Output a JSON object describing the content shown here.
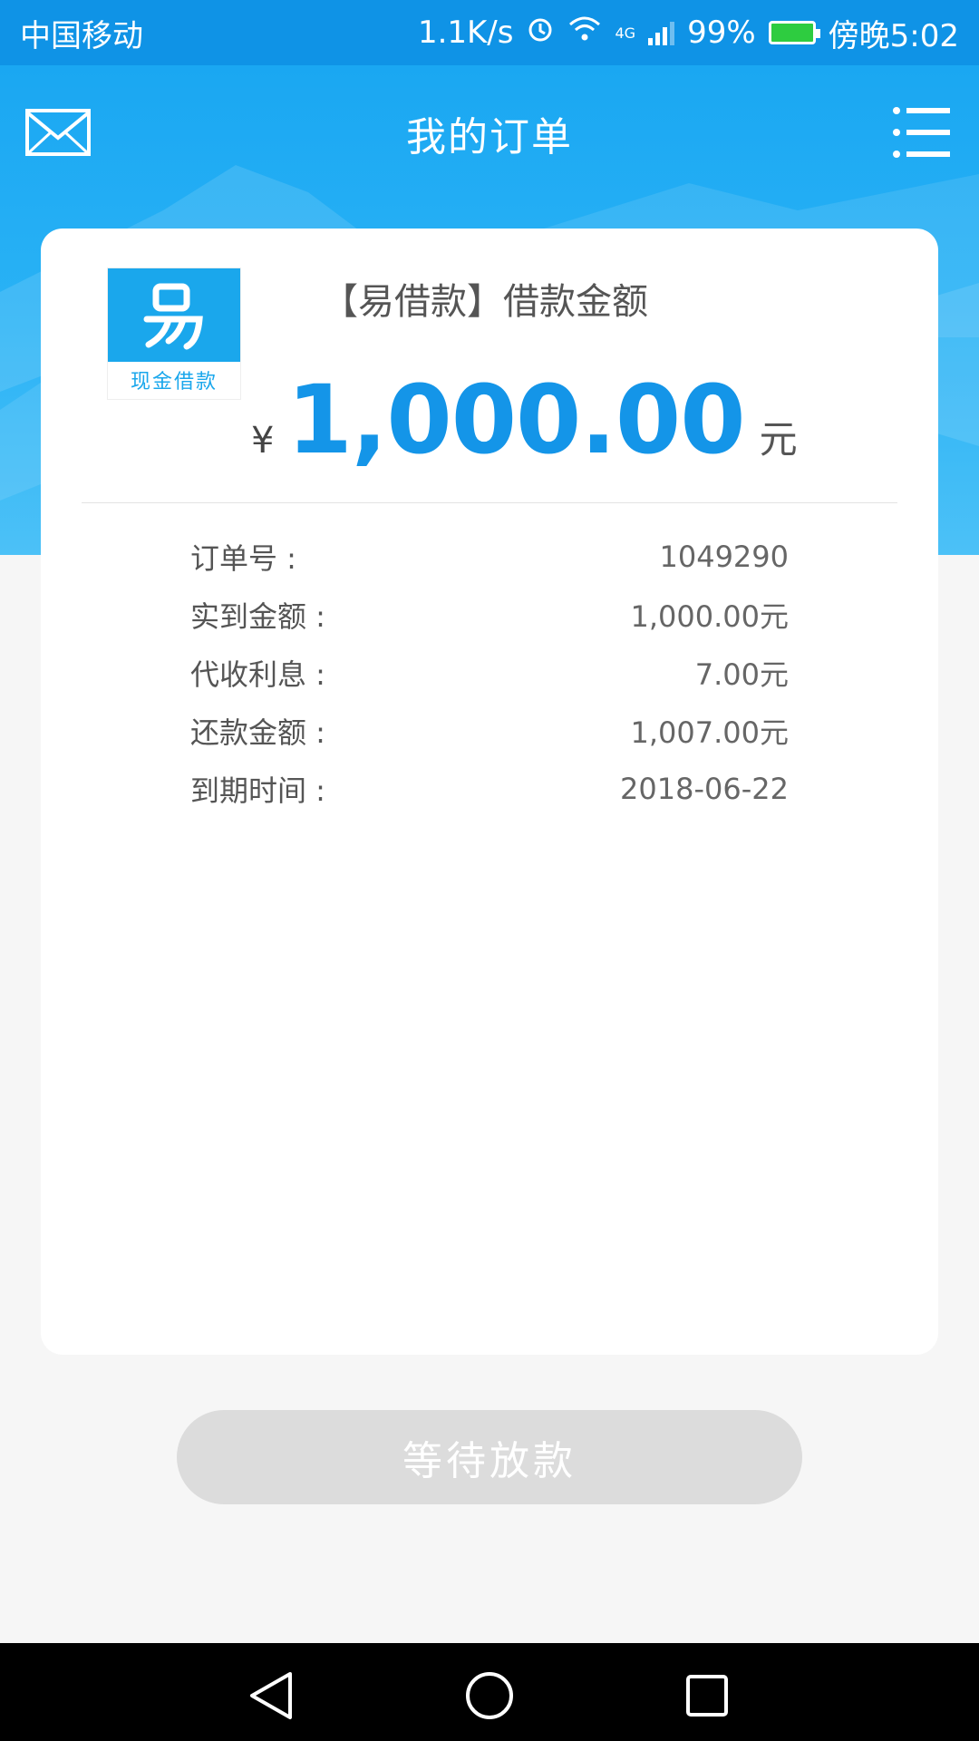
{
  "status_bar": {
    "carrier": "中国移动",
    "speed": "1.1K/s",
    "network": "4G",
    "battery": "99%",
    "time": "傍晚5:02"
  },
  "header": {
    "title": "我的订单"
  },
  "order": {
    "logo_text": "现金借款",
    "loan_title": "【易借款】借款金额",
    "currency_symbol": "¥",
    "amount": "1,000.00",
    "amount_unit": "元",
    "details": [
      {
        "label": "订单号 :",
        "value": "1049290"
      },
      {
        "label": "实到金额 :",
        "value": "1,000.00元"
      },
      {
        "label": "代收利息 :",
        "value": "7.00元"
      },
      {
        "label": "还款金额 :",
        "value": "1,007.00元"
      },
      {
        "label": "到期时间 :",
        "value": "2018-06-22"
      }
    ]
  },
  "action": {
    "button_label": "等待放款"
  },
  "colors": {
    "primary": "#1495e8",
    "header_blue": "#1aa7f2",
    "button_disabled": "#dcdcdc"
  }
}
